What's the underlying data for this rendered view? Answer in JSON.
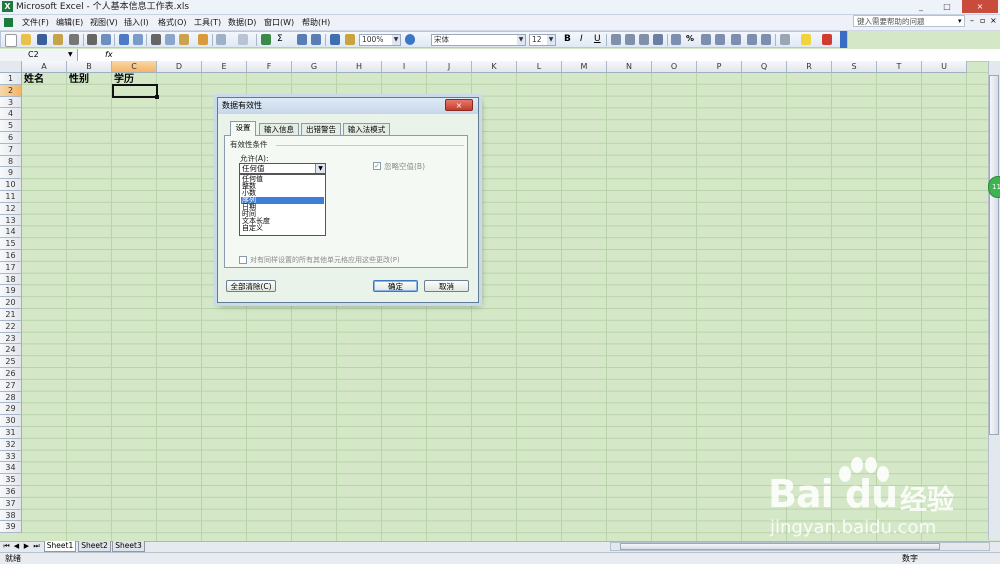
{
  "window": {
    "app_icon": "X",
    "title": "Microsoft Excel - 个人基本信息工作表.xls",
    "buttons": [
      "_",
      "□",
      "×"
    ]
  },
  "menu": [
    "文件(F)",
    "编辑(E)",
    "视图(V)",
    "插入(I)",
    "格式(O)",
    "工具(T)",
    "数据(D)",
    "窗口(W)",
    "帮助(H)"
  ],
  "help_placeholder": "键入需要帮助的问题",
  "toolbar": {
    "zoom": "100%",
    "font": "宋体",
    "font_size": "12",
    "bold": "B",
    "italic": "I",
    "underline": "U",
    "sum": "Σ",
    "percent": "%"
  },
  "formula_bar": {
    "name_box": "C2",
    "fx": "fx"
  },
  "columns": [
    "A",
    "B",
    "C",
    "D",
    "E",
    "F",
    "G",
    "H",
    "I",
    "J",
    "K",
    "L",
    "M",
    "N",
    "O",
    "P",
    "Q",
    "R",
    "S",
    "T",
    "U"
  ],
  "rows": [
    "1",
    "2",
    "3",
    "4",
    "5",
    "6",
    "7",
    "8",
    "9",
    "10",
    "11",
    "12",
    "13",
    "14",
    "15",
    "16",
    "17",
    "18",
    "19",
    "20",
    "21",
    "22",
    "23",
    "24",
    "25",
    "26",
    "27",
    "28",
    "29",
    "30",
    "31",
    "32",
    "33",
    "34",
    "35",
    "36",
    "37",
    "38",
    "39"
  ],
  "cells": {
    "A1": "姓名",
    "B1": "性别",
    "C1": "学历"
  },
  "dialog": {
    "title": "数据有效性",
    "close": "×",
    "tabs": [
      "设置",
      "输入信息",
      "出错警告",
      "输入法模式"
    ],
    "section": "有效性条件",
    "allow_label": "允许(A):",
    "allow_value": "任何值",
    "options": [
      "任何值",
      "整数",
      "小数",
      "序列",
      "日期",
      "时间",
      "文本长度",
      "自定义"
    ],
    "selected_option": "序列",
    "ignore_blank": "忽略空值(B)",
    "apply_all": "对有同样设置的所有其他单元格应用这些更改(P)",
    "clear_all": "全部清除(C)",
    "ok": "确定",
    "cancel": "取消"
  },
  "sheets": [
    "Sheet1",
    "Sheet2",
    "Sheet3"
  ],
  "sheet_nav": [
    "⏮",
    "◀",
    "▶",
    "⏭"
  ],
  "status": {
    "left": "就绪",
    "right": "数字"
  },
  "side_widget": "11",
  "watermark": {
    "logo": "Bai du",
    "cn": "经验",
    "url": "jingyan.baidu.com"
  },
  "colors": {
    "sheet_bg": "#d4e8c8",
    "gridline": "#b9d3ab",
    "selected_header": "#f3b564",
    "selection_blue": "#3d7fd6"
  }
}
